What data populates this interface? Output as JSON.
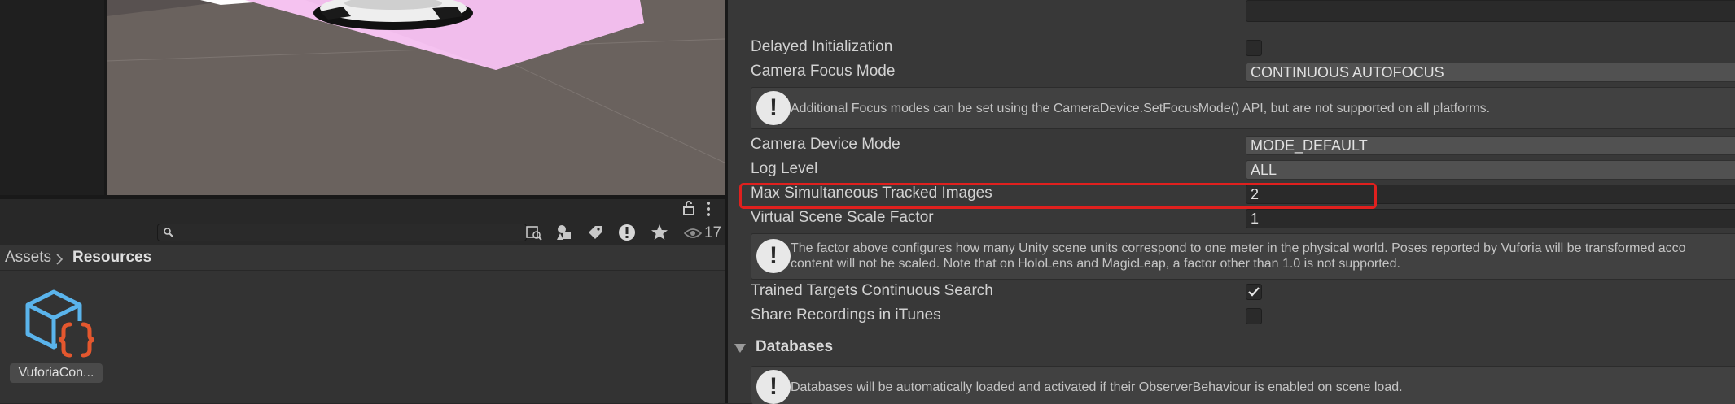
{
  "project": {
    "breadcrumb": [
      "Assets",
      "Resources"
    ],
    "hidden_count": "17",
    "asset": {
      "label": "VuforiaCon...",
      "icon": "vuforia-config-icon"
    }
  },
  "inspector": {
    "delayed_initialization": {
      "label": "Delayed Initialization",
      "checked": false
    },
    "camera_focus_mode": {
      "label": "Camera Focus Mode",
      "value": "CONTINUOUS AUTOFOCUS"
    },
    "focus_help": "Additional Focus modes can be set using the CameraDevice.SetFocusMode() API, but are not supported on all platforms.",
    "camera_device_mode": {
      "label": "Camera Device Mode",
      "value": "MODE_DEFAULT"
    },
    "log_level": {
      "label": "Log Level",
      "value": "ALL"
    },
    "max_tracked_images": {
      "label": "Max Simultaneous Tracked Images",
      "value": "2"
    },
    "virtual_scene_scale": {
      "label": "Virtual Scene Scale Factor",
      "value": "1"
    },
    "scale_help_line1": "The factor above configures how many Unity scene units correspond to one meter in the physical world. Poses reported by Vuforia will be transformed acco",
    "scale_help_line2": "content will not be scaled. Note that on HoloLens and MagicLeap, a factor other than 1.0 is not supported.",
    "trained_targets": {
      "label": "Trained Targets Continuous Search",
      "checked": true
    },
    "share_recordings": {
      "label": "Share Recordings in iTunes",
      "checked": false
    },
    "databases_section": "Databases",
    "databases_help": "Databases will be automatically loaded and activated if their ObserverBehaviour is enabled on scene load."
  },
  "colors": {
    "highlight": "#e0201e",
    "plane": "#f5c2f0",
    "asset_blue": "#5ab4ec",
    "asset_orange": "#e4572e"
  }
}
